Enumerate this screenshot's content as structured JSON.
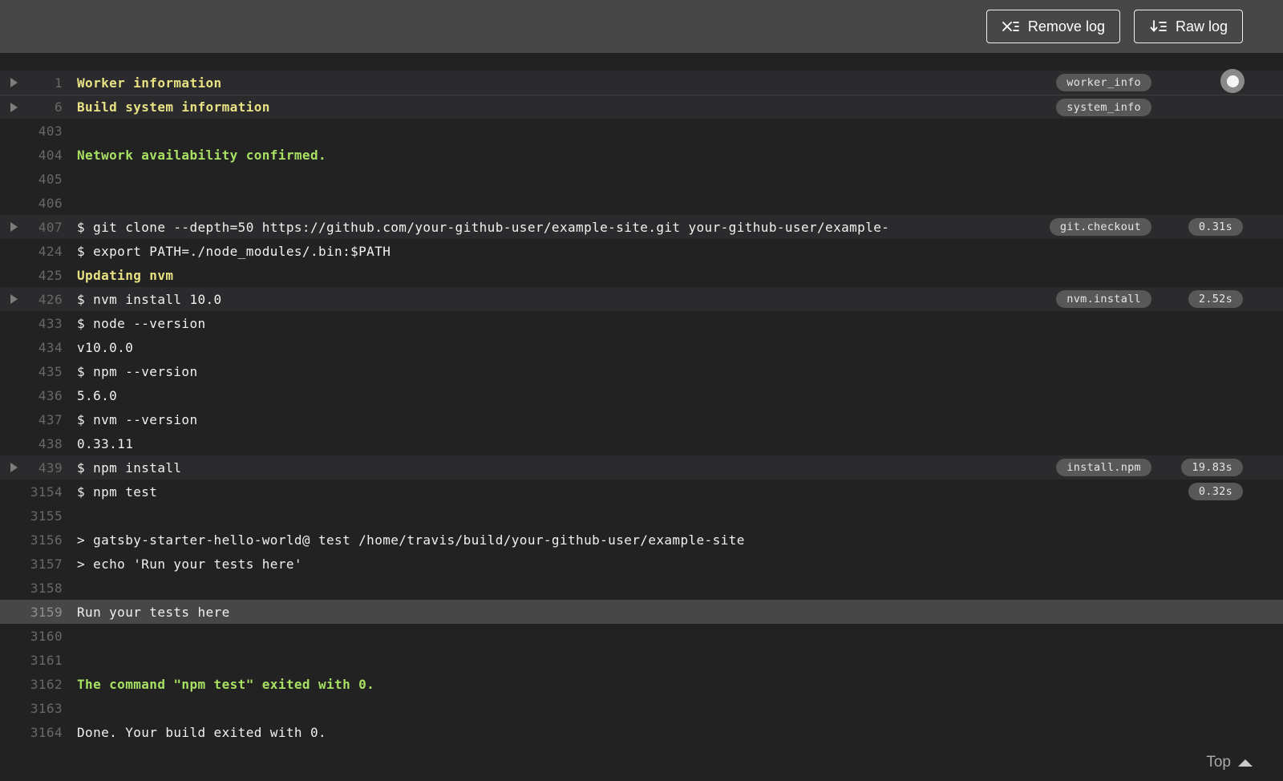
{
  "topbar": {
    "remove_log_label": "Remove log",
    "raw_log_label": "Raw log"
  },
  "colors": {
    "topbar_bg": "#474747",
    "log_bg": "#222222",
    "fold_row_bg": "#2b2b2d",
    "highlight_row_bg": "#474747",
    "section_yellow": "#e9e284",
    "success_green": "#a8e063",
    "pill_bg": "#585858",
    "line_number_gray": "#686868"
  },
  "log": {
    "top_link_label": "Top",
    "lines": [
      {
        "num": "1",
        "text": "Worker information",
        "style": "yellow",
        "fold": true,
        "tag": "worker_info"
      },
      {
        "num": "6",
        "text": "Build system information",
        "style": "yellow",
        "fold": true,
        "tag": "system_info"
      },
      {
        "num": "403",
        "text": ""
      },
      {
        "num": "404",
        "text": "Network availability confirmed.",
        "style": "green"
      },
      {
        "num": "405",
        "text": ""
      },
      {
        "num": "406",
        "text": ""
      },
      {
        "num": "407",
        "text": "$ git clone --depth=50 https://github.com/your-github-user/example-site.git your-github-user/example-",
        "fold": true,
        "tag": "git.checkout",
        "duration": "0.31s"
      },
      {
        "num": "424",
        "text": "$ export PATH=./node_modules/.bin:$PATH"
      },
      {
        "num": "425",
        "text": "Updating nvm",
        "style": "yellow"
      },
      {
        "num": "426",
        "text": "$ nvm install 10.0",
        "fold": true,
        "tag": "nvm.install",
        "duration": "2.52s"
      },
      {
        "num": "433",
        "text": "$ node --version"
      },
      {
        "num": "434",
        "text": "v10.0.0"
      },
      {
        "num": "435",
        "text": "$ npm --version"
      },
      {
        "num": "436",
        "text": "5.6.0"
      },
      {
        "num": "437",
        "text": "$ nvm --version"
      },
      {
        "num": "438",
        "text": "0.33.11"
      },
      {
        "num": "439",
        "text": "$ npm install",
        "fold": true,
        "tag": "install.npm",
        "duration": "19.83s"
      },
      {
        "num": "3154",
        "text": "$ npm test",
        "duration": "0.32s"
      },
      {
        "num": "3155",
        "text": ""
      },
      {
        "num": "3156",
        "text": "> gatsby-starter-hello-world@ test /home/travis/build/your-github-user/example-site"
      },
      {
        "num": "3157",
        "text": "> echo 'Run your tests here'"
      },
      {
        "num": "3158",
        "text": ""
      },
      {
        "num": "3159",
        "text": "Run your tests here",
        "highlight": true
      },
      {
        "num": "3160",
        "text": ""
      },
      {
        "num": "3161",
        "text": ""
      },
      {
        "num": "3162",
        "text": "The command \"npm test\" exited with 0.",
        "style": "green"
      },
      {
        "num": "3163",
        "text": ""
      },
      {
        "num": "3164",
        "text": "Done. Your build exited with 0."
      }
    ]
  }
}
